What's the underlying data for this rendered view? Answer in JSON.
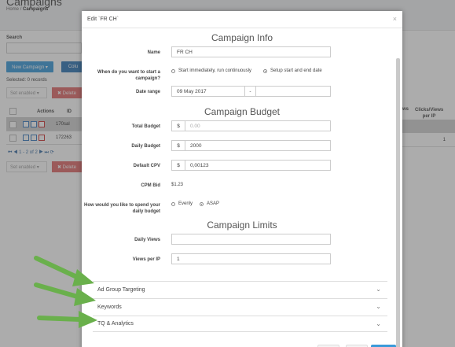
{
  "background": {
    "page_title": "Campaigns",
    "breadcrumb": {
      "home": "Home",
      "separator": "/",
      "current": "Campaigns"
    },
    "search_label": "Search",
    "new_campaign_label": "New Campaign ▾",
    "columns_label": "Colu",
    "selected_text": "Selected: 0 records",
    "select_placeholder": "Set enabled ▾",
    "delete_label": "✖ Delete",
    "table": {
      "headers": {
        "actions": "Actions",
        "id": "ID",
        "views": "ws",
        "clicks_views": "Clicks/Views per IP"
      },
      "rows": [
        {
          "id": "170sal",
          "clicks": ""
        },
        {
          "id": "172263",
          "clicks": "1"
        }
      ]
    },
    "pager": {
      "text": "1 - 2 of 2"
    }
  },
  "modal": {
    "title": "Edit `FR CH`",
    "close_label": "×",
    "campaign_info": {
      "heading": "Campaign Info",
      "name_label": "Name",
      "name_value": "FR CH",
      "start_label": "When do you want to start a campaign?",
      "start_options": [
        "Start immediately, run continuously",
        "Setup start and end date"
      ],
      "start_selected": 1,
      "date_label": "Date range",
      "date_start": "09 May 2017",
      "date_separator": "-",
      "date_end": ""
    },
    "campaign_budget": {
      "heading": "Campaign Budget",
      "total_label": "Total Budget",
      "total_currency": "$",
      "total_placeholder": "0.00",
      "daily_label": "Daily Budget",
      "daily_currency": "$",
      "daily_value": "2000",
      "cpv_label": "Default CPV",
      "cpv_currency": "$",
      "cpv_value": "0,00123",
      "cpm_label": "CPM Bid",
      "cpm_value": "$1.23",
      "spend_label": "How would you like to spend your daily budget",
      "spend_options": [
        "Evenly",
        "ASAP"
      ],
      "spend_selected": 1
    },
    "campaign_limits": {
      "heading": "Campaign Limits",
      "daily_views_label": "Daily Views",
      "daily_views_value": "",
      "views_per_ip_label": "Views per IP",
      "views_per_ip_value": "1"
    },
    "accordions": [
      "Ad Group Targeting",
      "Keywords",
      "TQ & Analytics"
    ],
    "accordion_icon": "chevron-down-icon"
  },
  "colors": {
    "overlay": "#464646",
    "arrow": "#6ab04c",
    "primary": "#3a9ad9",
    "danger": "#e06b6b"
  }
}
